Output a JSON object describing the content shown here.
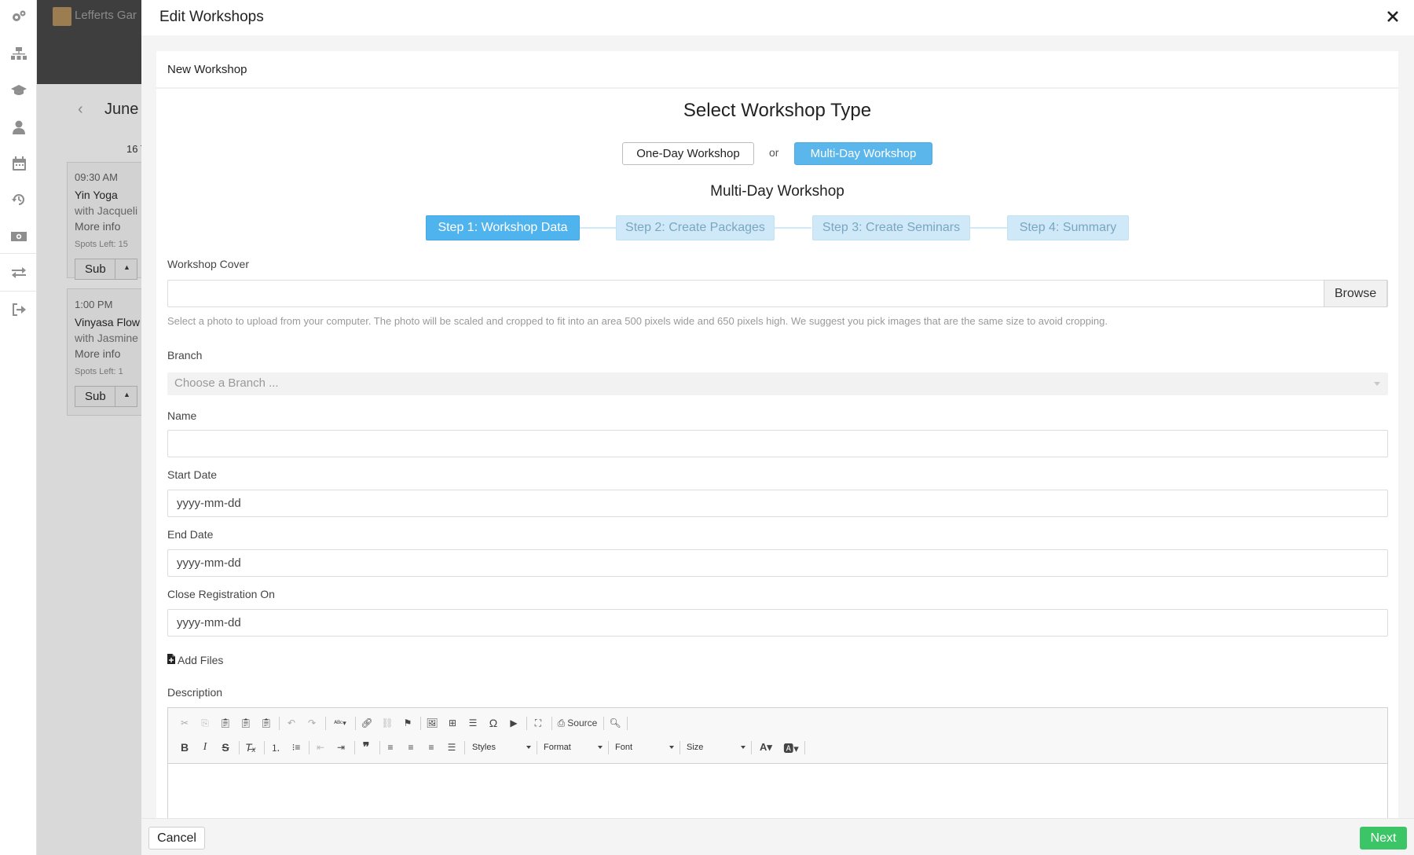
{
  "background": {
    "brand": "Lefferts Gar",
    "month": "June",
    "count": "16 T",
    "classes": [
      {
        "time": "09:30 AM",
        "name": "Yin Yoga",
        "with": "with Jacqueli",
        "more": "More info",
        "spots": "Spots Left: 15",
        "sub": "Sub"
      },
      {
        "time": "1:00 PM",
        "name": "Vinyasa Flow",
        "with": "with Jasmine",
        "more": "More info",
        "spots": "Spots Left: 1",
        "sub": "Sub"
      }
    ]
  },
  "modal": {
    "title": "Edit Workshops",
    "card_title": "New Workshop",
    "select_type_heading": "Select Workshop Type",
    "type_options": {
      "one_day": "One-Day Workshop",
      "or": "or",
      "multi_day": "Multi-Day Workshop"
    },
    "selected_type_heading": "Multi-Day Workshop",
    "steps": [
      "Step 1: Workshop Data",
      "Step 2: Create Packages",
      "Step 3: Create Seminars",
      "Step 4: Summary"
    ],
    "active_step": 1,
    "form": {
      "cover_label": "Workshop Cover",
      "browse_label": "Browse",
      "cover_help": "Select a photo to upload from your computer. The photo will be scaled and cropped to fit into an area 500 pixels wide and 650 pixels high. We suggest you pick images that are the same size to avoid cropping.",
      "branch_label": "Branch",
      "branch_placeholder": "Choose a Branch ...",
      "name_label": "Name",
      "name_value": "",
      "start_label": "Start Date",
      "start_value": "yyyy-mm-dd",
      "end_label": "End Date",
      "end_value": "yyyy-mm-dd",
      "close_label": "Close Registration On",
      "close_value": "yyyy-mm-dd",
      "add_files": "Add Files",
      "description_label": "Description"
    },
    "editor": {
      "source_label": "Source",
      "styles_label": "Styles",
      "format_label": "Format",
      "font_label": "Font",
      "size_label": "Size"
    },
    "footer": {
      "cancel": "Cancel",
      "next": "Next"
    }
  },
  "colors": {
    "accent": "#5bb6ec",
    "step_inactive": "#cfe9f8",
    "next_button": "#3cc566"
  },
  "icons": {
    "rail": [
      "gears-icon",
      "sitemap-icon",
      "graduation-cap-icon",
      "user-icon",
      "calendar-icon",
      "history-icon",
      "money-icon",
      "exchange-icon",
      "sign-out-icon"
    ]
  }
}
